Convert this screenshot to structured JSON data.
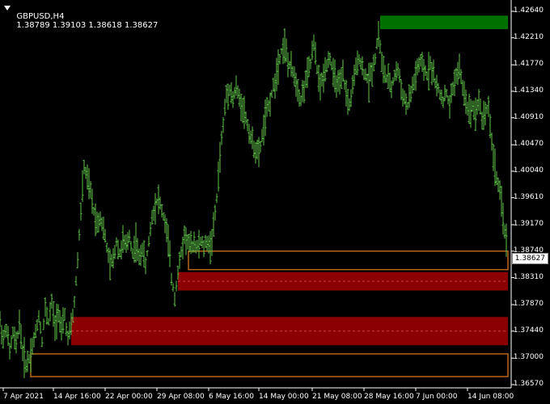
{
  "header": {
    "symbol": "GBPUSD,H4",
    "ohlc": "1.38789 1.39103 1.38618 1.38627"
  },
  "colors": {
    "background": "#000000",
    "axis": "#ffffff",
    "bar": "#5fc24a",
    "supply_zone": "#007000",
    "demand_zone": "#8b0000",
    "zone_outline": "#b5651d"
  },
  "chart_data": {
    "type": "ohlc-bar",
    "ylim": [
      1.3657,
      1.4264
    ],
    "yticks": [
      "1.42640",
      "1.42210",
      "1.41770",
      "1.41340",
      "1.40910",
      "1.40470",
      "1.40040",
      "1.39610",
      "1.39170",
      "1.38740",
      "1.38310",
      "1.37870",
      "1.37440",
      "1.37000",
      "1.36570"
    ],
    "xticks": [
      "7 Apr 2021",
      "14 Apr 16:00",
      "22 Apr 00:00",
      "29 Apr 08:00",
      "6 May 16:00",
      "14 May 00:00",
      "21 May 08:00",
      "28 May 16:00",
      "7 Jun 00:00",
      "14 Jun 08:00"
    ],
    "last_price": "1.38627",
    "price_path": [
      [
        0,
        1.376
      ],
      [
        4,
        1.373
      ],
      [
        8,
        1.375
      ],
      [
        12,
        1.371
      ],
      [
        16,
        1.374
      ],
      [
        20,
        1.372
      ],
      [
        24,
        1.376
      ],
      [
        28,
        1.371
      ],
      [
        32,
        1.369
      ],
      [
        36,
        1.37
      ],
      [
        40,
        1.372
      ],
      [
        44,
        1.374
      ],
      [
        48,
        1.377
      ],
      [
        52,
        1.373
      ],
      [
        56,
        1.378
      ],
      [
        60,
        1.376
      ],
      [
        64,
        1.379
      ],
      [
        68,
        1.375
      ],
      [
        72,
        1.378
      ],
      [
        76,
        1.374
      ],
      [
        80,
        1.377
      ],
      [
        84,
        1.373
      ],
      [
        88,
        1.375
      ],
      [
        92,
        1.379
      ],
      [
        96,
        1.386
      ],
      [
        100,
        1.394
      ],
      [
        104,
        1.401
      ],
      [
        108,
        1.399
      ],
      [
        112,
        1.397
      ],
      [
        116,
        1.394
      ],
      [
        120,
        1.392
      ],
      [
        124,
        1.393
      ],
      [
        128,
        1.391
      ],
      [
        132,
        1.388
      ],
      [
        136,
        1.385
      ],
      [
        140,
        1.386
      ],
      [
        144,
        1.389
      ],
      [
        148,
        1.387
      ],
      [
        152,
        1.389
      ],
      [
        156,
        1.388
      ],
      [
        160,
        1.39
      ],
      [
        164,
        1.387
      ],
      [
        168,
        1.389
      ],
      [
        172,
        1.386
      ],
      [
        176,
        1.388
      ],
      [
        180,
        1.385
      ],
      [
        184,
        1.389
      ],
      [
        188,
        1.393
      ],
      [
        192,
        1.395
      ],
      [
        196,
        1.396
      ],
      [
        200,
        1.394
      ],
      [
        204,
        1.392
      ],
      [
        208,
        1.389
      ],
      [
        212,
        1.383
      ],
      [
        216,
        1.38
      ],
      [
        220,
        1.384
      ],
      [
        224,
        1.387
      ],
      [
        228,
        1.39
      ],
      [
        232,
        1.389
      ],
      [
        236,
        1.388
      ],
      [
        240,
        1.389
      ],
      [
        244,
        1.388
      ],
      [
        248,
        1.389
      ],
      [
        252,
        1.388
      ],
      [
        256,
        1.389
      ],
      [
        260,
        1.388
      ],
      [
        264,
        1.391
      ],
      [
        268,
        1.396
      ],
      [
        272,
        1.403
      ],
      [
        276,
        1.408
      ],
      [
        280,
        1.413
      ],
      [
        284,
        1.414
      ],
      [
        288,
        1.412
      ],
      [
        292,
        1.414
      ],
      [
        296,
        1.412
      ],
      [
        300,
        1.411
      ],
      [
        304,
        1.409
      ],
      [
        308,
        1.407
      ],
      [
        312,
        1.405
      ],
      [
        316,
        1.404
      ],
      [
        320,
        1.403
      ],
      [
        324,
        1.406
      ],
      [
        328,
        1.409
      ],
      [
        332,
        1.411
      ],
      [
        336,
        1.413
      ],
      [
        340,
        1.415
      ],
      [
        344,
        1.418
      ],
      [
        348,
        1.42
      ],
      [
        352,
        1.421
      ],
      [
        356,
        1.418
      ],
      [
        360,
        1.417
      ],
      [
        364,
        1.416
      ],
      [
        368,
        1.414
      ],
      [
        372,
        1.412
      ],
      [
        376,
        1.414
      ],
      [
        380,
        1.416
      ],
      [
        384,
        1.418
      ],
      [
        388,
        1.421
      ],
      [
        392,
        1.417
      ],
      [
        396,
        1.414
      ],
      [
        400,
        1.416
      ],
      [
        404,
        1.418
      ],
      [
        408,
        1.419
      ],
      [
        412,
        1.416
      ],
      [
        416,
        1.415
      ],
      [
        420,
        1.414
      ],
      [
        424,
        1.416
      ],
      [
        428,
        1.413
      ],
      [
        432,
        1.411
      ],
      [
        436,
        1.414
      ],
      [
        440,
        1.417
      ],
      [
        444,
        1.419
      ],
      [
        448,
        1.417
      ],
      [
        452,
        1.416
      ],
      [
        456,
        1.415
      ],
      [
        460,
        1.417
      ],
      [
        464,
        1.419
      ],
      [
        468,
        1.423
      ],
      [
        472,
        1.418
      ],
      [
        476,
        1.416
      ],
      [
        480,
        1.415
      ],
      [
        484,
        1.414
      ],
      [
        488,
        1.416
      ],
      [
        492,
        1.417
      ],
      [
        496,
        1.414
      ],
      [
        500,
        1.412
      ],
      [
        504,
        1.411
      ],
      [
        508,
        1.413
      ],
      [
        512,
        1.415
      ],
      [
        516,
        1.417
      ],
      [
        520,
        1.418
      ],
      [
        524,
        1.417
      ],
      [
        528,
        1.416
      ],
      [
        532,
        1.418
      ],
      [
        536,
        1.416
      ],
      [
        540,
        1.414
      ],
      [
        544,
        1.413
      ],
      [
        548,
        1.412
      ],
      [
        552,
        1.413
      ],
      [
        556,
        1.411
      ],
      [
        560,
        1.414
      ],
      [
        564,
        1.416
      ],
      [
        568,
        1.417
      ],
      [
        572,
        1.414
      ],
      [
        576,
        1.412
      ],
      [
        580,
        1.41
      ],
      [
        584,
        1.411
      ],
      [
        588,
        1.41
      ],
      [
        592,
        1.412
      ],
      [
        596,
        1.409
      ],
      [
        600,
        1.41
      ],
      [
        604,
        1.411
      ],
      [
        608,
        1.405
      ],
      [
        612,
        1.401
      ],
      [
        616,
        1.398
      ],
      [
        620,
        1.395
      ],
      [
        624,
        1.391
      ],
      [
        628,
        1.3863
      ]
    ],
    "zones": [
      {
        "kind": "supply",
        "from_x_label": "28 May 16:00",
        "top": 1.4257,
        "bottom": 1.4235
      },
      {
        "kind": "demand-outline",
        "top": 1.3874,
        "bottom": 1.3844
      },
      {
        "kind": "demand",
        "top": 1.384,
        "bottom": 1.381
      },
      {
        "kind": "demand",
        "top": 1.3767,
        "bottom": 1.3721
      },
      {
        "kind": "demand-outline",
        "top": 1.3707,
        "bottom": 1.367
      }
    ]
  }
}
